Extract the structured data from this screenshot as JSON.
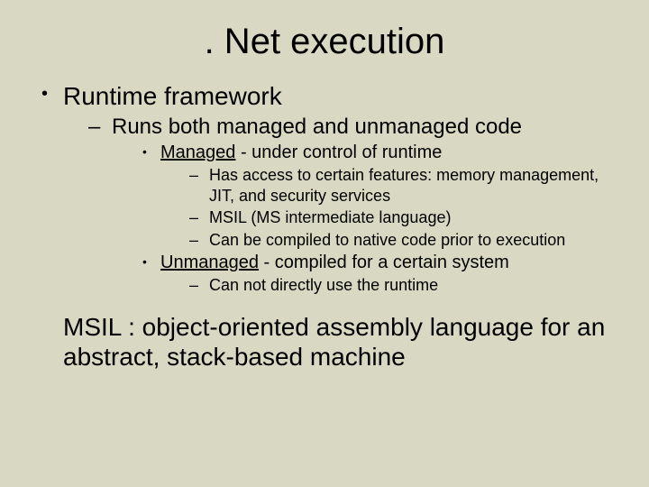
{
  "title": ". Net execution",
  "bullets": {
    "l1": "Runtime framework",
    "l2": "Runs both managed and unmanaged code",
    "managed": {
      "term": "Managed",
      "rest": " - under control of runtime"
    },
    "managed_sub": [
      "Has access to certain features: memory management, JIT, and security services",
      "MSIL (MS intermediate language)",
      "Can be compiled to native code prior to execution"
    ],
    "unmanaged": {
      "term": "Unmanaged",
      "rest": " - compiled for a certain system"
    },
    "unmanaged_sub": [
      "Can not directly use the runtime"
    ]
  },
  "footer": "MSIL : object-oriented assembly language for an abstract, stack-based machine"
}
